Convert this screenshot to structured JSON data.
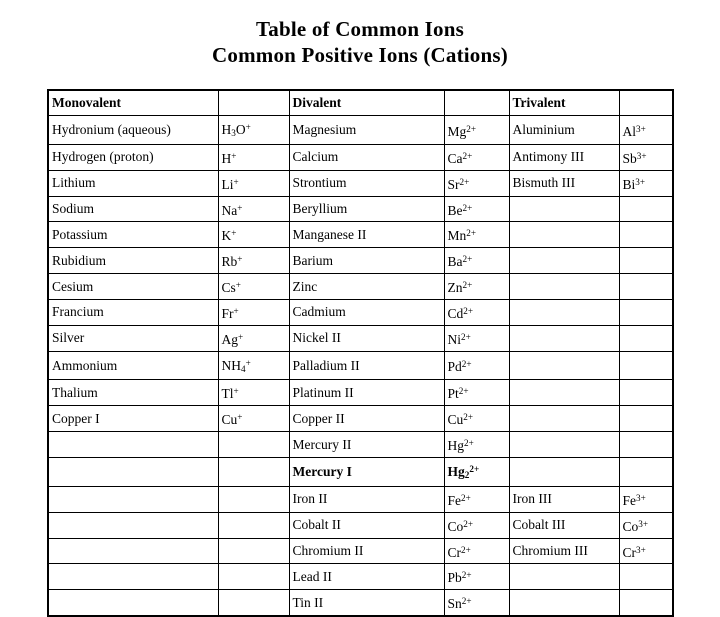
{
  "title": {
    "line1": "Table of Common Ions",
    "line2": "Common Positive Ions (Cations)"
  },
  "table": {
    "headers": {
      "monovalent": "Monovalent",
      "monovalent_formula": "",
      "divalent": "Divalent",
      "divalent_formula": "",
      "trivalent": "Trivalent",
      "trivalent_formula": ""
    },
    "columns": [
      "Monovalent",
      "",
      "Divalent",
      "",
      "Trivalent",
      ""
    ],
    "row_count": 16,
    "rows": [
      {
        "bold": true,
        "cells": [
          "Monovalent",
          "",
          "Divalent",
          "",
          "Trivalent",
          ""
        ]
      },
      {
        "bold": false,
        "cells": [
          "Hydronium (aqueous)",
          "H<sub>3</sub>O<sup>+</sup>",
          "Magnesium",
          "Mg<sup>2+</sup>",
          "Aluminium",
          "Al<sup>3+</sup>"
        ]
      },
      {
        "bold": false,
        "cells": [
          "Hydrogen (proton)",
          "H<sup>+</sup>",
          "Calcium",
          "Ca<sup>2+</sup>",
          "Antimony III",
          "Sb<sup>3+</sup>"
        ]
      },
      {
        "bold": false,
        "cells": [
          "Lithium",
          "Li<sup>+</sup>",
          "Strontium",
          "Sr<sup>2+</sup>",
          "Bismuth III",
          "Bi<sup>3+</sup>"
        ]
      },
      {
        "bold": false,
        "cells": [
          "Sodium",
          "Na<sup>+</sup>",
          "Beryllium",
          "Be<sup>2+</sup>",
          "",
          ""
        ]
      },
      {
        "bold": false,
        "cells": [
          "Potassium",
          "K<sup>+</sup>",
          "Manganese II",
          "Mn<sup>2+</sup>",
          "",
          ""
        ]
      },
      {
        "bold": false,
        "cells": [
          "Rubidium",
          "Rb<sup>+</sup>",
          "Barium",
          "Ba<sup>2+</sup>",
          "",
          ""
        ]
      },
      {
        "bold": false,
        "cells": [
          "Cesium",
          "Cs<sup>+</sup>",
          "Zinc",
          "Zn<sup>2+</sup>",
          "",
          ""
        ]
      },
      {
        "bold": false,
        "cells": [
          "Francium",
          "Fr<sup>+</sup>",
          "Cadmium",
          "Cd<sup>2+</sup>",
          "",
          ""
        ]
      },
      {
        "bold": false,
        "cells": [
          "Silver",
          "Ag<sup>+</sup>",
          "Nickel II",
          "Ni<sup>2+</sup>",
          "",
          ""
        ]
      },
      {
        "bold": false,
        "cells": [
          "Ammonium",
          "NH<sub>4</sub><sup>+</sup>",
          "Palladium II",
          "Pd<sup>2+</sup>",
          "",
          ""
        ]
      },
      {
        "bold": false,
        "cells": [
          "Thalium",
          "Tl<sup>+</sup>",
          "Platinum II",
          "Pt<sup>2+</sup>",
          "",
          ""
        ]
      },
      {
        "bold": false,
        "cells": [
          "Copper I",
          "Cu<sup>+</sup>",
          "Copper II",
          "Cu<sup>2+</sup>",
          "",
          ""
        ]
      },
      {
        "bold": false,
        "cells": [
          "",
          "",
          "Mercury II",
          "Hg<sup>2+</sup>",
          "",
          ""
        ]
      },
      {
        "bold": true,
        "cells": [
          "",
          "",
          "Mercury I",
          "Hg<sub>2</sub><sup>2+</sup>",
          "",
          ""
        ]
      },
      {
        "bold": false,
        "cells": [
          "",
          "",
          "Iron II",
          "Fe<sup>2+</sup>",
          "Iron III",
          "Fe<sup>3+</sup>"
        ]
      },
      {
        "bold": false,
        "cells": [
          "",
          "",
          "Cobalt II",
          "Co<sup>2+</sup>",
          "Cobalt III",
          "Co<sup>3+</sup>"
        ]
      },
      {
        "bold": false,
        "cells": [
          "",
          "",
          "Chromium II",
          "Cr<sup>2+</sup>",
          "Chromium III",
          "Cr<sup>3+</sup>"
        ]
      },
      {
        "bold": false,
        "cells": [
          "",
          "",
          "Lead II",
          "Pb<sup>2+</sup>",
          "",
          ""
        ]
      },
      {
        "bold": false,
        "cells": [
          "",
          "",
          "Tin II",
          "Sn<sup>2+</sup>",
          "",
          ""
        ]
      }
    ]
  },
  "colors": {
    "background": "#ffffff",
    "text": "#000000",
    "border": "#000000"
  }
}
